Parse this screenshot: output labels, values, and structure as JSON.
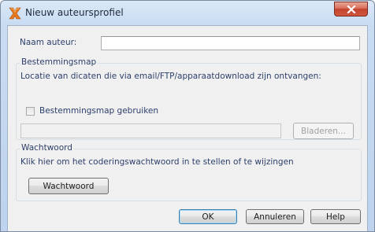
{
  "window": {
    "title": "Nieuw auteursprofiel",
    "close_symbol": "×"
  },
  "author": {
    "label": "Naam auteur:",
    "value": "",
    "placeholder": ""
  },
  "destination": {
    "group_title": "Bestemmingsmap",
    "description": "Locatie van dicaten die via email/FTP/apparaatdownload zijn ontvangen:",
    "checkbox_label": "Bestemmingsmap gebruiken",
    "checkbox_checked": false,
    "path_value": "",
    "browse_label": "Bladeren..."
  },
  "password": {
    "group_title": "Wachtwoord",
    "description": "Klik hier om het coderingswachtwoord in te stellen of te wijzingen",
    "button_label": "Wachtwoord"
  },
  "footer": {
    "ok_label": "OK",
    "cancel_label": "Annuleren",
    "help_label": "Help"
  },
  "colors": {
    "accent": "#3c7fb1",
    "label_text": "#2c3f6b",
    "close_button": "#c24430"
  },
  "icons": {
    "app": "app-logo-icon",
    "close": "close-icon"
  }
}
